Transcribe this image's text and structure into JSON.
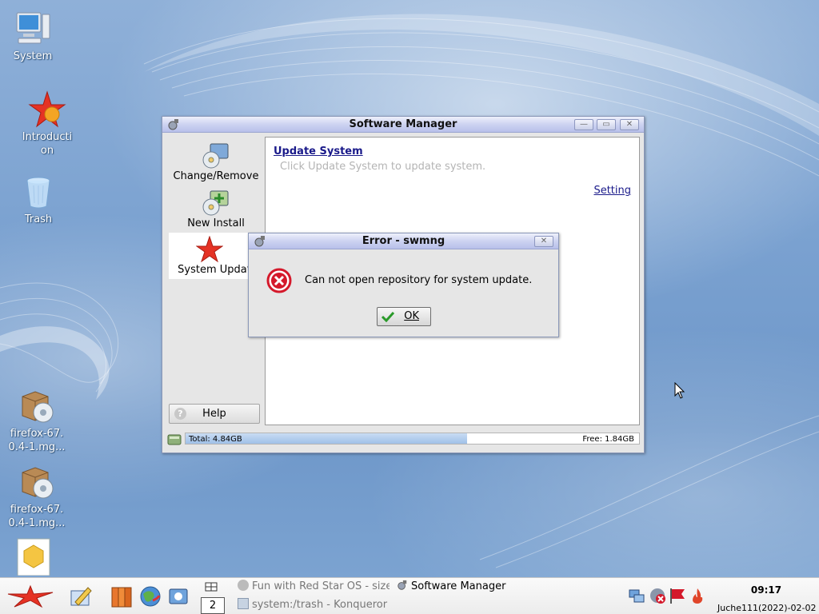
{
  "desktop": {
    "icons": [
      {
        "label": "System",
        "icon": "computer-icon"
      },
      {
        "label": "Introduction",
        "icon": "red-star-icon"
      },
      {
        "label": "Trash",
        "icon": "trash-icon"
      },
      {
        "label": "firefox-67.0.4-1.mg...",
        "icon": "package-icon"
      },
      {
        "label": "firefox-67.0.4-1.mg...",
        "icon": "package-icon"
      },
      {
        "label": "",
        "icon": "document-icon"
      }
    ]
  },
  "window": {
    "title": "Software Manager",
    "sidebar": [
      {
        "label": "Change/Remove",
        "icon": "cd-monitor-icon"
      },
      {
        "label": "New Install",
        "icon": "cd-add-icon"
      },
      {
        "label": "System Updat",
        "icon": "red-star-icon",
        "active": true
      }
    ],
    "help_label": "Help",
    "content": {
      "heading": "Update System",
      "hint": "Click Update System to update system.",
      "setting_link": "Setting"
    },
    "status": {
      "total": "Total: 4.84GB",
      "free": "Free: 1.84GB",
      "used_fraction": 0.62
    }
  },
  "dialog": {
    "title": "Error - swmng",
    "message": "Can not open repository for system update.",
    "ok_label": "OK"
  },
  "taskbar": {
    "pager_number": "2",
    "tasks": [
      {
        "label": "Fun with Red Star OS - size",
        "icon": "globe-icon"
      },
      {
        "label": "Software Manager",
        "icon": "software-manager-icon"
      },
      {
        "label": "system:/trash - Konqueror",
        "icon": "folder-icon"
      }
    ],
    "clock": "09:17",
    "date": "Juche111(2022)-02-02"
  },
  "colors": {
    "link": "#1a1a8a",
    "titlebar": "#c4cbee",
    "progress": "#a8c6ec",
    "error": "#d4192b"
  }
}
